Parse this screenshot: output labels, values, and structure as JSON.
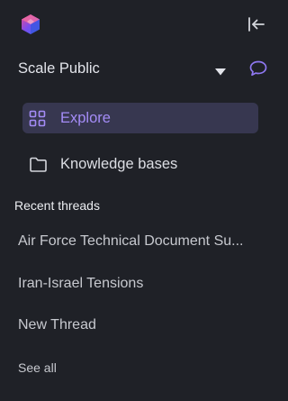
{
  "sidebar": {
    "logo_icon": "scale-logo-icon",
    "collapse_icon": "collapse-sidebar-icon",
    "workspace": {
      "name": "Scale Public",
      "caret_icon": "caret-down-icon",
      "new_thread_icon": "chat-bubble-icon"
    },
    "nav": [
      {
        "label": "Explore",
        "icon": "grid-icon",
        "active": true
      },
      {
        "label": "Knowledge bases",
        "icon": "folder-icon",
        "active": false
      }
    ],
    "recent_threads_label": "Recent threads",
    "threads": [
      {
        "title": "Air Force Technical Document Su..."
      },
      {
        "title": "Iran-Israel Tensions"
      },
      {
        "title": "New Thread"
      }
    ],
    "see_all_label": "See all"
  },
  "colors": {
    "background": "#1f2127",
    "accent": "#a48cf7",
    "active_item_bg": "#373750"
  }
}
